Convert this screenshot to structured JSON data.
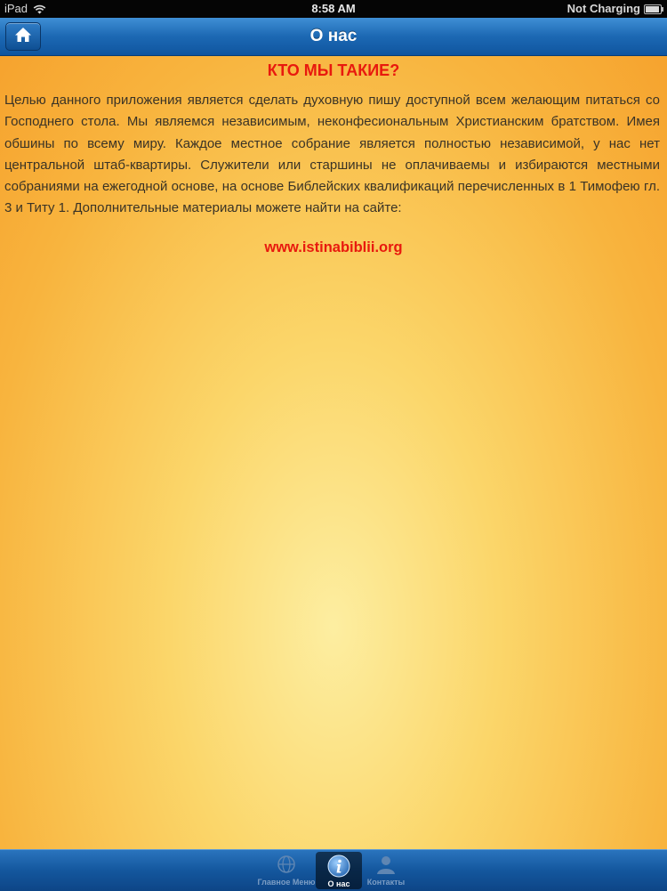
{
  "status_bar": {
    "device": "iPad",
    "time": "8:58 AM",
    "battery_status": "Not Charging"
  },
  "navbar": {
    "title": "О нас",
    "home_icon": "home-icon"
  },
  "content": {
    "heading": "КТО МЫ ТАКИЕ?",
    "body": "Целью данного приложения является сделать духовную пишу доступной всем желающим питаться со Господнего стола. Мы являемся независимым, неконфесиональным Христианским братством. Имея обшины по всему миру. Каждое местное собрание является полностью независимой, у нас нет центральной штаб-квартиры. Служители или старшины не оплачиваемы и избираются местными собраниями на ежегодной основе, на основе Библейских квалификаций перечисленных в 1 Тимофею гл. 3 и Титу 1. Дополнительные материалы можете найти на сайте:",
    "link": "www.istinabiblii.org"
  },
  "tabbar": {
    "tabs": [
      {
        "label": "Главное Меню",
        "icon": "globe-icon",
        "active": false
      },
      {
        "label": "О нас",
        "icon": "info-icon",
        "active": true
      },
      {
        "label": "Контакты",
        "icon": "person-icon",
        "active": false
      }
    ]
  },
  "colors": {
    "accent_red": "#e8190e",
    "nav_blue": "#1c68b3"
  }
}
